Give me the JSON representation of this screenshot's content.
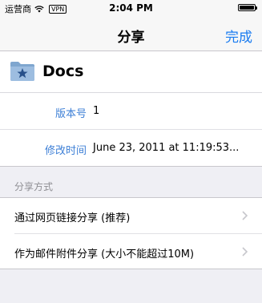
{
  "status_bar": {
    "carrier": "运营商",
    "vpn": "VPN",
    "time": "2:04 PM"
  },
  "nav": {
    "title": "分享",
    "done_label": "完成"
  },
  "file": {
    "name": "Docs",
    "icon": "folder-icon"
  },
  "info": [
    {
      "label": "版本号",
      "value": "1"
    },
    {
      "label": "修改时间",
      "value": "June 23, 2011 at 11:19:53..."
    }
  ],
  "share": {
    "section_title": "分享方式",
    "items": [
      {
        "label": "通过网页链接分享 (推荐)"
      },
      {
        "label": "作为邮件附件分享 (大小不能超过10M)"
      }
    ]
  },
  "colors": {
    "accent": "#1a7cf0",
    "label_blue": "#3d7fd6",
    "background": "#efeff4"
  }
}
